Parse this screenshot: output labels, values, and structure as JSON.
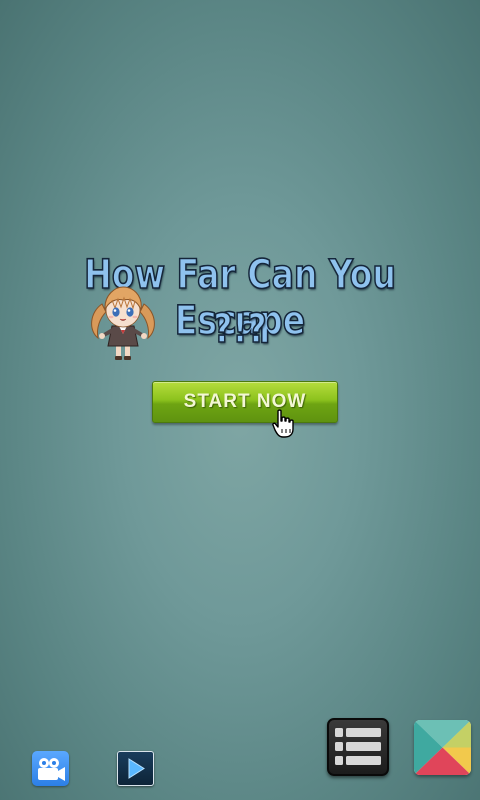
{
  "title": {
    "line1": "How Far Can You Escape",
    "line2": "?!?"
  },
  "start_button": {
    "label": "START NOW"
  },
  "bottom_bar": {
    "video_icon": "video-camera-icon",
    "play_icon": "play-icon",
    "list_icon": "list-menu-icon",
    "store_icon": "play-store-icon"
  },
  "colors": {
    "title_fill": "#8fc2ee",
    "title_outline": "#15263a",
    "button_green": "#8cc21d",
    "background": "#6f9999"
  }
}
